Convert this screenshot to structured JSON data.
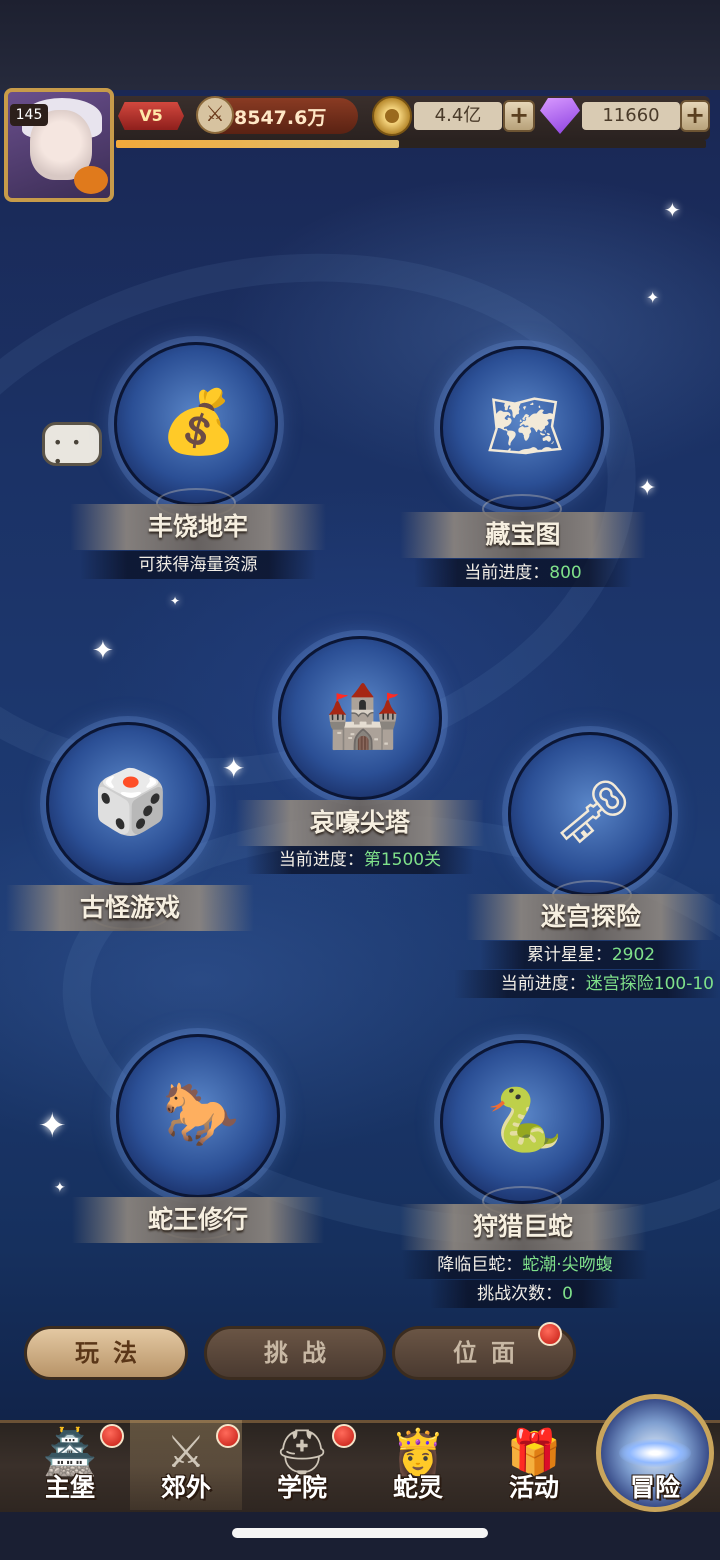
{
  "header": {
    "player_level": "145",
    "vip": "V5",
    "power": "8547.6万",
    "gold": "4.4亿",
    "diamonds": "11660",
    "exp_progress_percent": 48,
    "icons": {
      "avatar": "player-avatar",
      "power": "sword-icon",
      "gold": "gold-coin-icon",
      "diamond": "purple-gem-icon",
      "add": "plus-icon"
    }
  },
  "features": {
    "dungeon": {
      "title": "丰饶地牢",
      "line1": "可获得海量资源"
    },
    "treasure_map": {
      "title": "藏宝图",
      "line1_label": "当前进度：",
      "line1_value": "800"
    },
    "tower": {
      "title": "哀嚎尖塔",
      "line1_label": "当前进度：",
      "line1_value": "第1500关"
    },
    "odd_game": {
      "title": "古怪游戏"
    },
    "maze": {
      "title": "迷宫探险",
      "line1_label": "累计星星：",
      "line1_value": "2902",
      "line2_label": "当前进度：",
      "line2_value": "迷宫探险100-10"
    },
    "snake_king": {
      "title": "蛇王修行"
    },
    "hunt_snake": {
      "title": "狩猎巨蛇",
      "line1_label": "降临巨蛇：",
      "line1_value": "蛇潮·尖吻蝮",
      "line2_label": "挑战次数：",
      "line2_value": "0"
    }
  },
  "tabs": [
    {
      "label": "玩法",
      "active": true
    },
    {
      "label": "挑战",
      "active": false
    },
    {
      "label": "位面",
      "active": false,
      "badge": true
    }
  ],
  "bottom_nav": [
    {
      "label": "主堡",
      "badge": true
    },
    {
      "label": "郊外",
      "badge": true,
      "active": true
    },
    {
      "label": "学院",
      "badge": true
    },
    {
      "label": "蛇灵",
      "badge": false
    },
    {
      "label": "活动",
      "badge": false
    },
    {
      "label": "冒险",
      "badge": false
    }
  ],
  "colors": {
    "accent_green": "#7fe08a",
    "badge_red": "#c21b12",
    "gold_frame": "#c79b4a"
  }
}
